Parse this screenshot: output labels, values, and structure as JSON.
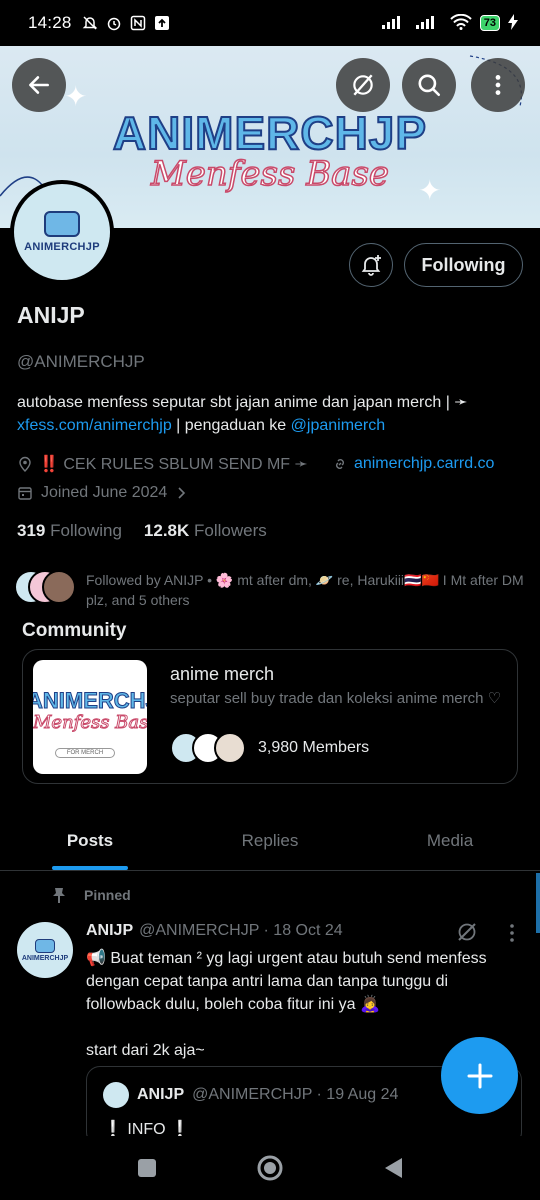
{
  "status_bar": {
    "time": "14:28",
    "battery": "73"
  },
  "banner": {
    "title": "ANIMERCHJP",
    "subtitle": "Menfess Base"
  },
  "profile": {
    "avatar_text": "ANIMERCHJP",
    "following_label": "Following",
    "name": "ANIJP",
    "handle": "@ANIMERCHJP",
    "bio_text1": "autobase menfess seputar sbt jajan anime dan japan merch | ➛",
    "bio_link1": "xfess.com/animerchjp",
    "bio_text2": " | pengaduan ke ",
    "bio_link2": "@jpanimerch",
    "location": "‼️ CEK RULES SBLUM SEND MF ➛",
    "website": "animerchjp.carrd.co",
    "joined": "Joined June 2024",
    "following_count": "319",
    "following_label_stat": "Following",
    "followers_count": "12.8K",
    "followers_label": "Followers",
    "followed_by": "Followed by ANIJP • 🌸 mt after dm, 🪐 re, Harukiii🇹🇭🇨🇳 I Mt after DM plz, and 5 others"
  },
  "community": {
    "heading": "Community",
    "image_title": "ANIMERCHJP",
    "image_sub": "Menfess Base",
    "image_tag": "FOR MERCH",
    "name": "anime merch",
    "description": "seputar sell buy trade dan koleksi anime merch ♡",
    "members": "3,980 Members"
  },
  "tabs": [
    {
      "label": "Posts"
    },
    {
      "label": "Replies"
    },
    {
      "label": "Media"
    }
  ],
  "post": {
    "pinned_label": "Pinned",
    "author": "ANIJP",
    "handle_date": "@ANIMERCHJP · 18 Oct 24",
    "body1": "📢 Buat teman ² yg lagi urgent atau butuh send menfess dengan cepat tanpa antri lama dan tanpa tunggu di followback dulu, boleh coba fitur ini ya 🙇‍♀️",
    "body2": "start dari 2k aja~",
    "quote_author": "ANIJP",
    "quote_handle_date": "@ANIMERCHJP · 19 Aug 24",
    "quote_body": "❕ INFO ❕"
  },
  "colors": {
    "accent": "#1d9bf0",
    "background": "#000000",
    "muted": "#71767b",
    "border": "#2f3336"
  }
}
